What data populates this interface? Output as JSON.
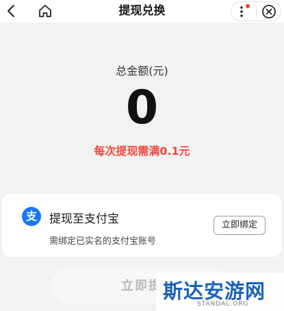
{
  "header": {
    "title": "提现兑换",
    "icons": [
      "chevron-left-icon",
      "home-icon",
      "more-vertical-icon",
      "close-circle-icon"
    ],
    "notification_dot_color": "#ff3b30"
  },
  "summary": {
    "total_label": "总金额(元)",
    "amount": "0",
    "hint": "每次提现需满0.1元",
    "hint_color": "#f0473c"
  },
  "payment_method": {
    "icon": "支",
    "icon_color": "#1677ff",
    "title": "提现至支付宝",
    "subtitle": "需绑定已实名的支付宝账号",
    "bind_button": "立即绑定"
  },
  "action": {
    "withdraw_button": "立即提"
  },
  "watermark": {
    "text": "斯达安游网",
    "sub": "STANDAL.ORG"
  }
}
